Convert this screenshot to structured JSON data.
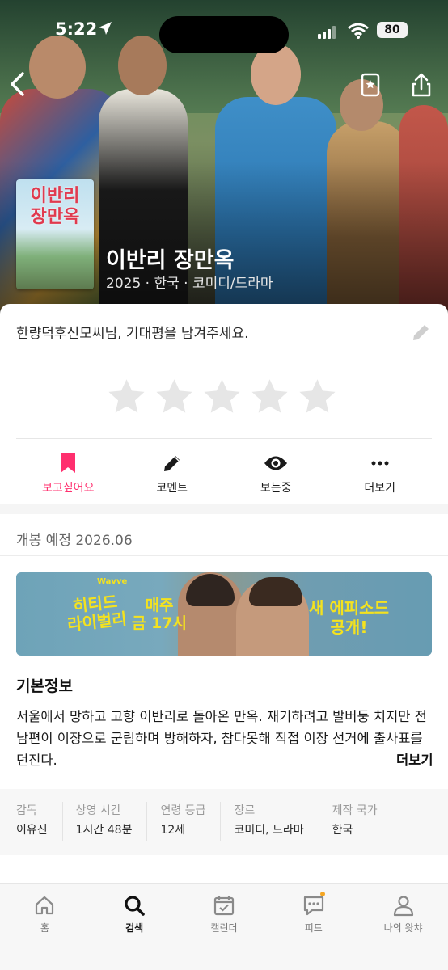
{
  "status_bar": {
    "time": "5:22",
    "battery": "80"
  },
  "movie": {
    "poster_title": "이반리 장만옥",
    "title": "이반리 장만옥",
    "meta": "2025 · 한국 · 코미디/드라마"
  },
  "rating": {
    "prompt": "한량덕후신모씨님, 기대평을 남겨주세요.",
    "stars": 5,
    "filled": 0
  },
  "actions": [
    {
      "label": "보고싶어요",
      "icon": "bookmark-icon",
      "active": true
    },
    {
      "label": "코멘트",
      "icon": "pencil-icon"
    },
    {
      "label": "보는중",
      "icon": "eye-icon"
    },
    {
      "label": "더보기",
      "icon": "more-icon"
    }
  ],
  "release": "개봉 예정 2026.06",
  "banner": {
    "small": "Wavve",
    "left": "히티드\n라이벌리",
    "middle": "매주\n금 17시",
    "right": "새 에피소드\n공개!"
  },
  "basic_info": {
    "title": "기본정보",
    "synopsis": "서울에서 망하고 고향 이반리로 돌아온 만옥. 재기하려고 발버둥 치지만 전남편이 이장으로 군림하며 방해하자, 참다못해 직접 이장 선거에 출사표를 던진다.",
    "more": "더보기"
  },
  "info_table": [
    {
      "label": "감독",
      "value": "이유진"
    },
    {
      "label": "상영 시간",
      "value": "1시간 48분"
    },
    {
      "label": "연령 등급",
      "value": "12세"
    },
    {
      "label": "장르",
      "value": "코미디, 드라마"
    },
    {
      "label": "제작 국가",
      "value": "한국"
    }
  ],
  "tabs": [
    {
      "label": "홈",
      "icon": "home-icon"
    },
    {
      "label": "검색",
      "icon": "search-icon",
      "active": true
    },
    {
      "label": "캘린더",
      "icon": "calendar-icon"
    },
    {
      "label": "피드",
      "icon": "feed-icon"
    },
    {
      "label": "나의 왓챠",
      "icon": "profile-icon"
    }
  ],
  "colors": {
    "accent": "#ff2f6e",
    "notification": "#f5a623"
  }
}
